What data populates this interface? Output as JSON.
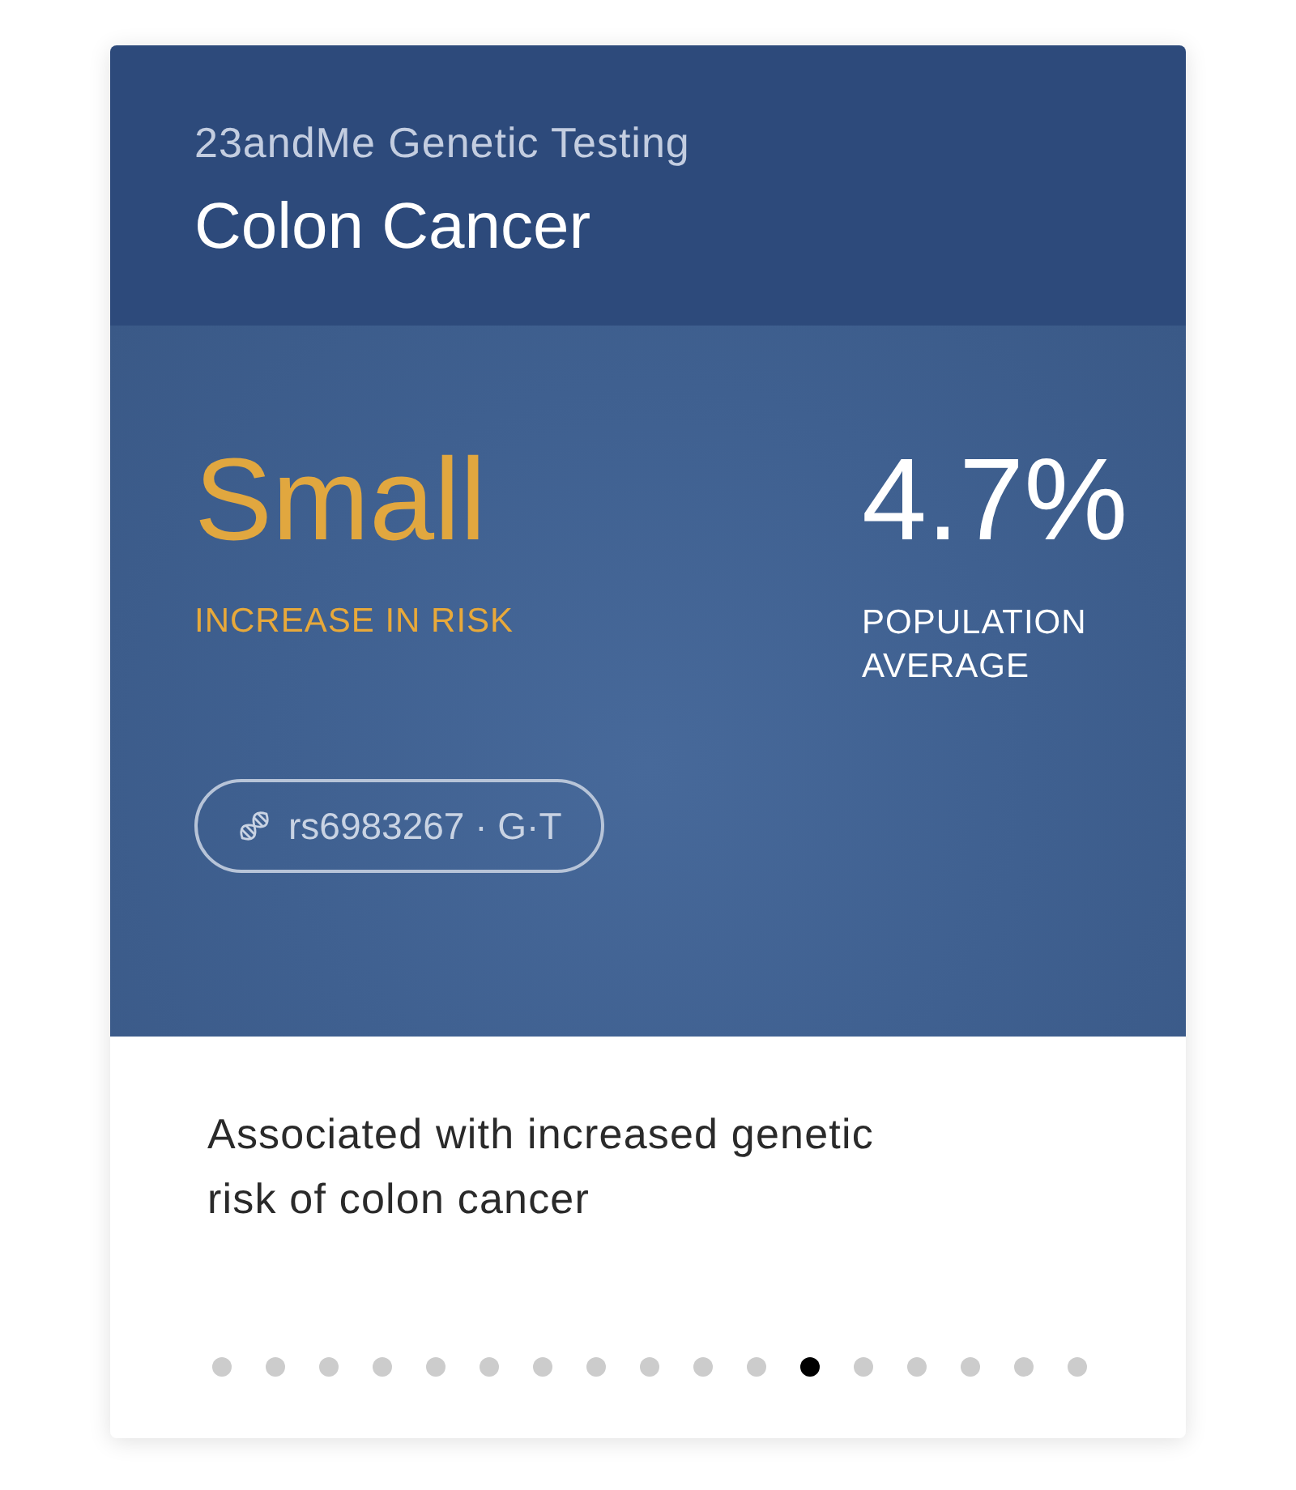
{
  "card": {
    "source": "23andMe Genetic Testing",
    "title": "Colon Cancer"
  },
  "result": {
    "level_label": "Small",
    "level_caption": "INCREASE IN RISK",
    "population_value": "4.7%",
    "population_caption": "POPULATION AVERAGE"
  },
  "variant_chip": {
    "label": "rs6983267 · G·T"
  },
  "description": "Associated with increased genetic risk of colon cancer",
  "pager": {
    "dots": [
      {
        "selected": false
      },
      {
        "selected": false
      },
      {
        "selected": false
      },
      {
        "selected": false
      },
      {
        "selected": false
      },
      {
        "selected": false
      },
      {
        "selected": false
      },
      {
        "selected": false
      },
      {
        "selected": false
      },
      {
        "selected": false
      },
      {
        "selected": false
      },
      {
        "selected": true
      },
      {
        "selected": false
      },
      {
        "selected": false
      },
      {
        "selected": false
      },
      {
        "selected": false
      },
      {
        "selected": false
      }
    ]
  }
}
